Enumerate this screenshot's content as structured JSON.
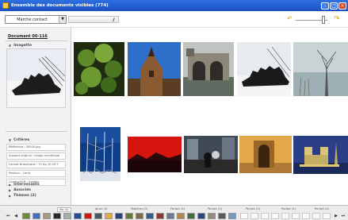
{
  "window": {
    "title": "Ensemble des documents visibles (774)"
  },
  "toolbar": {
    "mode_select": "Marche contact",
    "undo_icon": "undo-arrow-icon",
    "redo_icon": "redo-arrow-icon"
  },
  "sidebar": {
    "doc_title": "Document 00-116",
    "section_image": "Imagette",
    "section_criteria": "Critères",
    "properties": [
      "Référence : 00004.jpg",
      "Support original : Image numérique",
      "Format Numérique : TV Ap 10-29-T",
      "Position : Carré",
      "Couleur/N B : Couleur"
    ],
    "bottom_sections": [
      "Intervenants",
      "Associés",
      "Thèmes (2)"
    ]
  },
  "gallery": {
    "items": [
      "green-plant",
      "church-tower",
      "castle-arches",
      "sculpture-silhouette",
      "misty-tree",
      "sailboat-masts",
      "red-rooftop",
      "city-street",
      "orange-doorway",
      "notre-dame-night"
    ]
  },
  "bottombar": {
    "tabs": [
      "Mo (4)",
      "Ignor (3)",
      "Molières (3)",
      "Portait (3)",
      "Portait (3)",
      "Portait (3)",
      "Portait (3)",
      "Portait (3)"
    ],
    "active_tab": 0,
    "first_icon": "first-page-icon",
    "prev_icon": "previous-page-icon",
    "next_icon": "next-page-icon",
    "last_icon": "last-page-icon"
  },
  "colors": {
    "titlebar": "#1b4fc2",
    "accent": "#e0a000"
  }
}
